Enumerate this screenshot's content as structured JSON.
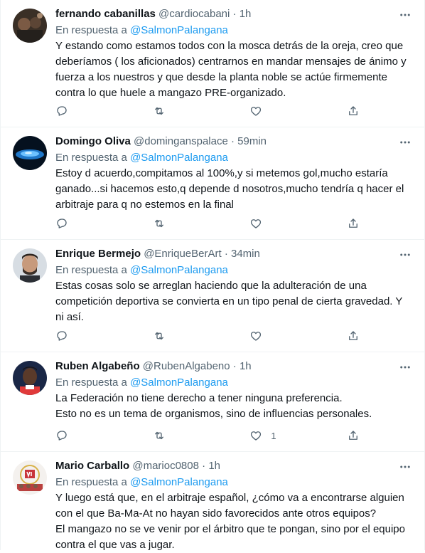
{
  "reply_prefix": "En respuesta a",
  "tweets": [
    {
      "name": "fernando cabanillas",
      "handle": "@cardiocabani",
      "time": "1h",
      "reply_to": "@SalmonPalangana",
      "text": "Y estando como estamos todos con la mosca detrás de la oreja, creo que deberíamos ( los aficionados) centrarnos en mandar mensajes de ánimo y fuerza a los nuestros y que desde la planta noble se actúe firmemente contra lo que huele a mangazo PRE-organizado.",
      "likes": ""
    },
    {
      "name": "Domingo Oliva",
      "handle": "@dominganspalace",
      "time": "59min",
      "reply_to": "@SalmonPalangana",
      "text": "Estoy d acuerdo,compitamos al 100%,y si metemos gol,mucho estaría ganado...si hacemos esto,q depende d nosotros,mucho tendría q hacer el arbitraje para q no estemos en la final",
      "likes": ""
    },
    {
      "name": "Enrique Bermejo",
      "handle": "@EnriqueBerArt",
      "time": "34min",
      "reply_to": "@SalmonPalangana",
      "text": "Estas cosas solo se arreglan haciendo que la adulteración de una competición deportiva se convierta en un tipo penal de cierta gravedad. Y ni así.",
      "likes": ""
    },
    {
      "name": "Ruben Algabeño",
      "handle": "@RubenAlgabeno",
      "time": "1h",
      "reply_to": "@SalmonPalangana",
      "text": "La Federación no tiene derecho a tener ninguna preferencia.\nEsto no es un tema de organismos, sino de influencias personales.",
      "likes": "1"
    },
    {
      "name": "Mario Carballo",
      "handle": "@marioc0808",
      "time": "1h",
      "reply_to": "@SalmonPalangana",
      "text": "Y luego está que, en el arbitraje español, ¿cómo va a encontrarse alguien con el que Ba-Ma-At no hayan sido favorecidos ante otros equipos?\nEl mangazo no se ve venir por el árbitro que te pongan, sino por el equipo contra el que vas a jugar.",
      "likes": ""
    }
  ],
  "icons": {
    "reply": "reply-icon",
    "retweet": "retweet-icon",
    "like": "heart-icon",
    "share": "share-icon",
    "more": "more-icon"
  },
  "colors": {
    "link": "#1d9bf0",
    "secondary_text": "#536471",
    "primary_text": "#0f1419",
    "divider": "#eff3f4"
  }
}
